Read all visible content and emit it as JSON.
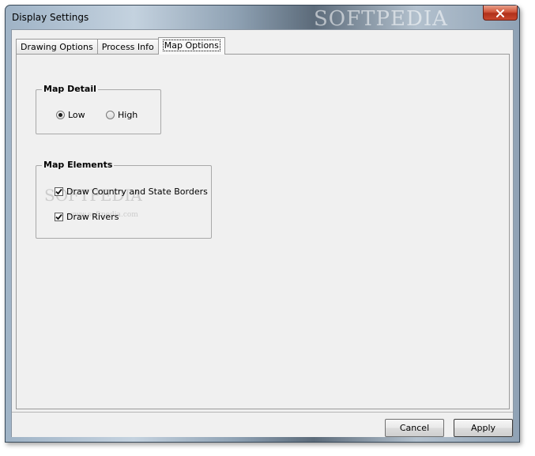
{
  "window": {
    "title": "Display Settings",
    "title_watermark": "SOFTPEDIA"
  },
  "tabs": [
    {
      "label": "Drawing Options",
      "active": false
    },
    {
      "label": "Process Info",
      "active": false
    },
    {
      "label": "Map Options",
      "active": true
    }
  ],
  "map_detail": {
    "title": "Map Detail",
    "options": [
      {
        "label": "Low",
        "selected": true
      },
      {
        "label": "High",
        "selected": false
      }
    ]
  },
  "map_elements": {
    "title": "Map Elements",
    "items": [
      {
        "label": "Draw Country and State Borders",
        "checked": true
      },
      {
        "label": "Draw Rivers",
        "checked": true
      }
    ],
    "watermark": "SOFTPEDIA",
    "watermark_sub": "www.softpedia.com"
  },
  "buttons": {
    "cancel": "Cancel",
    "apply": "Apply"
  },
  "icons": {
    "close": "close-icon",
    "radio": "radio-dot-icon",
    "check": "checkmark-icon"
  }
}
